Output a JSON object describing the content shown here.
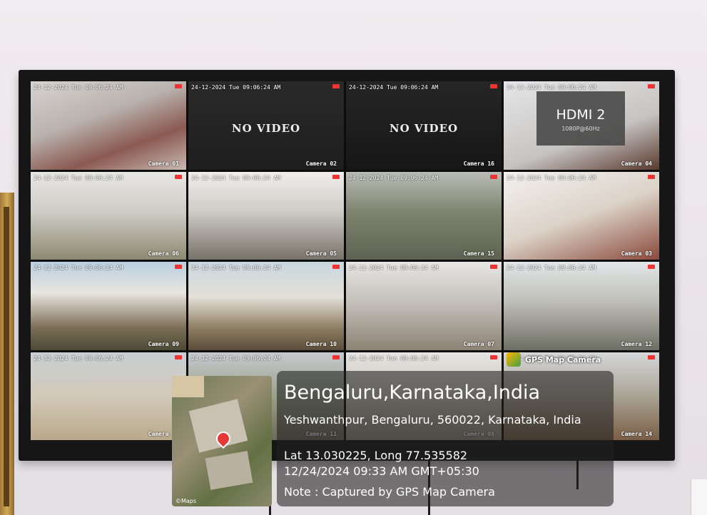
{
  "cameras": [
    {
      "ts": "24-12-2024 Tue 09:06:24 AM",
      "label": "Camera 01",
      "bg": "linear-gradient(160deg,#d8d4d2 0%,#b9b2ad 40%,#8a5a52 70%,#c9b9b3 100%)"
    },
    {
      "ts": "24-12-2024 Tue 09:06:24 AM",
      "label": "Camera 02",
      "bg": "linear-gradient(180deg,#2a2a2a,#1e1e1e)",
      "no_video": "NO VIDEO"
    },
    {
      "ts": "24-12-2024 Tue 09:06:24 AM",
      "label": "Camera 16",
      "bg": "linear-gradient(180deg,#262626,#161616)",
      "no_video": "NO VIDEO"
    },
    {
      "ts": "24-12-2024 Tue 09:06:24 AM",
      "label": "Camera 04",
      "bg": "linear-gradient(160deg,#e6e6e8,#c6c4c2 60%,#5a3a2e 100%)",
      "hdmi_title": "HDMI 2",
      "hdmi_sub": "1080P@60Hz"
    },
    {
      "ts": "24-12-2024 Tue 09:06:24 AM",
      "label": "Camera 06",
      "bg": "linear-gradient(180deg,#e7e7e5 0%,#cfcdc6 45%,#8d8a72 100%)"
    },
    {
      "ts": "24-12-2024 Tue 09:06:24 AM",
      "label": "Camera 05",
      "bg": "linear-gradient(180deg,#f0eeec 0%,#cfccc6 45%,#77736a 100%)"
    },
    {
      "ts": "24-12-2024 Tue 09:06:24 AM",
      "label": "Camera 15",
      "bg": "linear-gradient(180deg,#b9bdb7 0%,#7f8470 45%,#5d6352 100%)"
    },
    {
      "ts": "24-12-2024 Tue 09:06:24 AM",
      "label": "Camera 03",
      "bg": "linear-gradient(160deg,#f3f1ef 0%,#dcd3c8 50%,#8a4a3c 100%)"
    },
    {
      "ts": "24-12-2024 Tue 09:06:24 AM",
      "label": "Camera 09",
      "bg": "linear-gradient(180deg,#b9cfe0 0%,#e8e6e0 35%,#7b6d55 75%,#4b4a35 100%)"
    },
    {
      "ts": "24-12-2024 Tue 09:06:24 AM",
      "label": "Camera 10",
      "bg": "linear-gradient(180deg,#c9d7e0 0%,#e3e0d8 40%,#8d7e62 75%,#5c4d3a 100%)"
    },
    {
      "ts": "24-12-2024 Tue 09:06:24 AM",
      "label": "Camera 07",
      "bg": "linear-gradient(180deg,#e8e6e4 0%,#c4c0ba 45%,#8c8374 100%)"
    },
    {
      "ts": "24-12-2024 Tue 09:06:24 AM",
      "label": "Camera 12",
      "bg": "linear-gradient(180deg,#e3e6e8 0%,#bfbfb9 45%,#6d6e63 100%)"
    },
    {
      "ts": "24-12-2024 Tue 09:06:24 AM",
      "label": "Camera 13",
      "bg": "linear-gradient(180deg,#c8cfd4 0%,#d2c9b9 50%,#b9a98a 100%)"
    },
    {
      "ts": "24-12-2024 Tue 09:06:24 AM",
      "label": "Camera 11",
      "bg": "linear-gradient(180deg,#c6cad0 0%,#9aa08a 50%,#6d6a58 100%)"
    },
    {
      "ts": "24-12-2024 Tue 09:06:24 AM",
      "label": "Camera 08",
      "bg": "linear-gradient(180deg,#e8e6e3 0%,#c8c1b6 50%,#8e8576 100%)"
    },
    {
      "ts": "24-12-2024 Tue 09:06:24 AM",
      "label": "Camera 14",
      "bg": "linear-gradient(180deg,#d5d7d9 0%,#a9a394 50%,#7a5e45 100%)"
    }
  ],
  "gps_overlay": {
    "badge": "GPS Map Camera",
    "title": "Bengaluru,Karnataka,India",
    "address": "Yeshwanthpur, Bengaluru, 560022, Karnataka, India",
    "latlng": "Lat 13.030225, Long 77.535582",
    "datetime": "12/24/2024 09:33 AM GMT+05:30",
    "note": "Note : Captured by GPS Map Camera",
    "map_credit": "©Maps"
  },
  "colors": {
    "wall": "#ece7ea",
    "tv_bezel": "#161616",
    "record_indicator": "#e33333"
  }
}
